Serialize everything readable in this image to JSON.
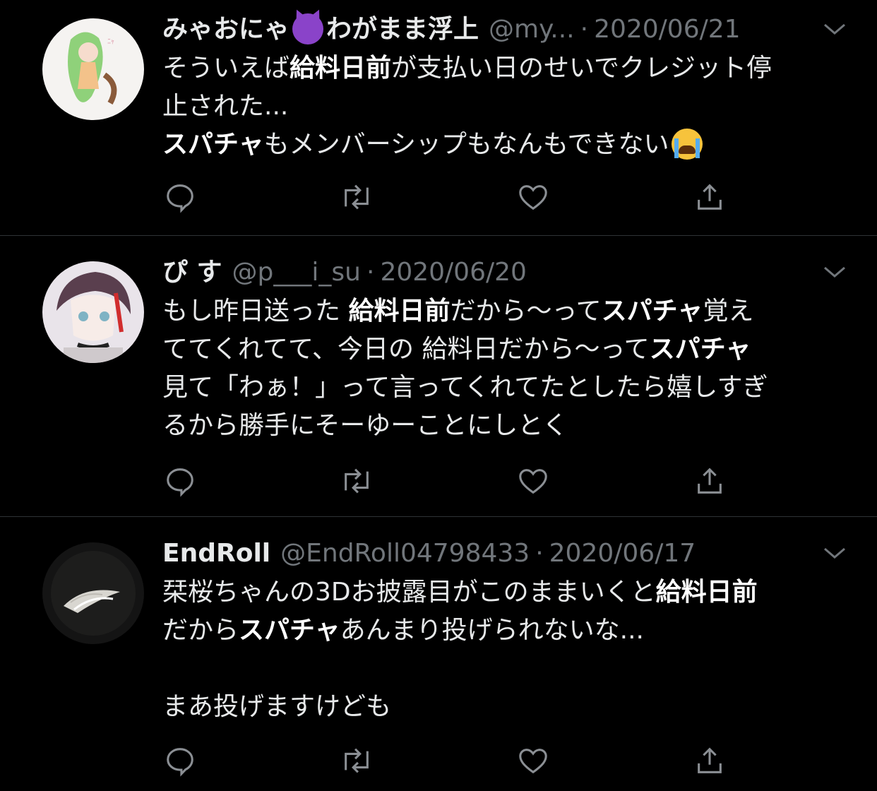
{
  "tweets": [
    {
      "name": "みゃおにゃ",
      "name_suffix": "わがまま浮上",
      "handle": "@my...",
      "date": "2020/06/21",
      "body": [
        [
          {
            "t": "そういえば"
          },
          {
            "t": "給料日前",
            "b": true
          },
          {
            "t": "が支払い日のせいでクレジット停"
          }
        ],
        [
          {
            "t": "止された..."
          }
        ],
        [
          {
            "t": "スパチャ",
            "b": true
          },
          {
            "t": "もメンバーシップもなんもできない"
          }
        ]
      ],
      "avatar": "avatar-anime-green-hair"
    },
    {
      "name": "ぴ す",
      "handle": "@p___i_su",
      "date": "2020/06/20",
      "body": [
        [
          {
            "t": "もし昨日送った "
          },
          {
            "t": "給料日前",
            "b": true
          },
          {
            "t": "だから〜って"
          },
          {
            "t": "スパチャ",
            "b": true
          },
          {
            "t": "覚え"
          }
        ],
        [
          {
            "t": "ててくれてて、今日の 給料日だから〜って"
          },
          {
            "t": "スパチャ",
            "b": true
          }
        ],
        [
          {
            "t": "見て「わぁ！」って言ってくれてたとしたら嬉しすぎ"
          }
        ],
        [
          {
            "t": "るから勝手にそーゆーことにしとく"
          }
        ]
      ],
      "avatar": "avatar-anime-purple-hair"
    },
    {
      "name": "EndRoll",
      "handle": "@EndRoll04798433",
      "date": "2020/06/17",
      "body": [
        [
          {
            "t": "栞桜ちゃんの3Dお披露目がこのままいくと"
          },
          {
            "t": "給料日前",
            "b": true
          }
        ],
        [
          {
            "t": "だから"
          },
          {
            "t": "スパチャ",
            "b": true
          },
          {
            "t": "あんまり投げられないな..."
          }
        ],
        [],
        [
          {
            "t": "まあ投げますけども"
          }
        ]
      ],
      "avatar": "avatar-dark-feather"
    }
  ],
  "action_icons": [
    "reply-icon",
    "retweet-icon",
    "like-icon",
    "share-icon"
  ],
  "colors": {
    "background": "#000000",
    "text": "#e7e9ea",
    "secondary": "#71767b",
    "divider": "#2f3336"
  }
}
